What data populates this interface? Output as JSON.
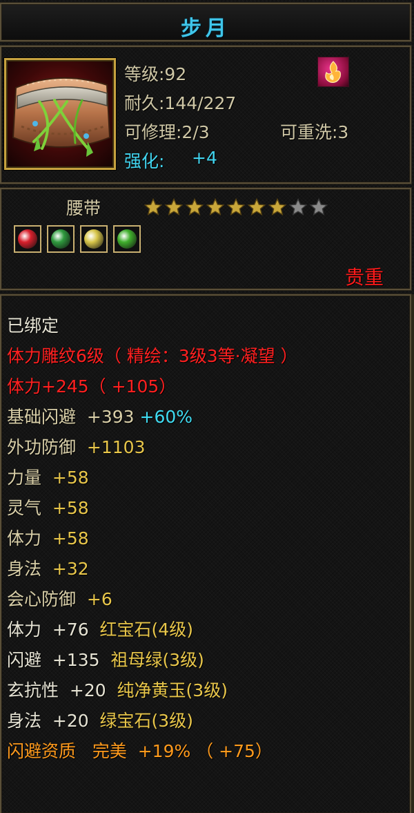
{
  "title": "步月",
  "title_color": "#3fc6ea",
  "item_icon": "belt-item-icon",
  "badge_icon": "flame-badge-icon",
  "stats": {
    "level": "等级:92",
    "durability": "耐久:144/227",
    "repair": "可修理:2/3",
    "rewash": "可重洗:3",
    "enhance_label": "强化:",
    "enhance_value": "+4"
  },
  "type": "腰带",
  "stars": {
    "filled": 7,
    "total": 9
  },
  "gems": [
    {
      "name": "ruby-gem-icon",
      "color": "#d8202c"
    },
    {
      "name": "emerald-gem-icon",
      "color": "#2f9a3e"
    },
    {
      "name": "jade-gem-icon",
      "color": "#d8c64a"
    },
    {
      "name": "green-gem-icon",
      "color": "#3fae2c"
    }
  ],
  "rarity": "贵重",
  "attributes": [
    {
      "parts": [
        {
          "text": "已绑定",
          "class": "c-white"
        }
      ]
    },
    {
      "parts": [
        {
          "text": "体力雕纹6级（ 精绘：3级3等·凝望 ）",
          "class": "c-red"
        }
      ]
    },
    {
      "parts": [
        {
          "text": "体力+245（ +105）",
          "class": "c-red"
        }
      ]
    },
    {
      "parts": [
        {
          "text": "基础闪避  +393 ",
          "class": "c-beige"
        },
        {
          "text": "+60%",
          "class": "c-cyan"
        }
      ]
    },
    {
      "parts": [
        {
          "text": "外功防御  ",
          "class": "c-beige"
        },
        {
          "text": "+1103",
          "class": "c-gold"
        }
      ]
    },
    {
      "parts": [
        {
          "text": "力量  ",
          "class": "c-beige"
        },
        {
          "text": "+58",
          "class": "c-gold"
        }
      ]
    },
    {
      "parts": [
        {
          "text": "灵气  ",
          "class": "c-beige"
        },
        {
          "text": "+58",
          "class": "c-gold"
        }
      ]
    },
    {
      "parts": [
        {
          "text": "体力  ",
          "class": "c-beige"
        },
        {
          "text": "+58",
          "class": "c-gold"
        }
      ]
    },
    {
      "parts": [
        {
          "text": "身法  ",
          "class": "c-beige"
        },
        {
          "text": "+32",
          "class": "c-gold"
        }
      ]
    },
    {
      "parts": [
        {
          "text": "会心防御  ",
          "class": "c-beige"
        },
        {
          "text": "+6",
          "class": "c-gold"
        }
      ]
    },
    {
      "parts": [
        {
          "text": "体力  +76  ",
          "class": "c-white"
        },
        {
          "text": "红宝石(4级)",
          "class": "c-gold"
        }
      ]
    },
    {
      "parts": [
        {
          "text": "闪避  +135  ",
          "class": "c-white"
        },
        {
          "text": "祖母绿(3级)",
          "class": "c-gold"
        }
      ]
    },
    {
      "parts": [
        {
          "text": "玄抗性  +20  ",
          "class": "c-white"
        },
        {
          "text": "纯净黄玉(3级)",
          "class": "c-gold"
        }
      ]
    },
    {
      "parts": [
        {
          "text": "身法  +20  ",
          "class": "c-white"
        },
        {
          "text": "绿宝石(3级)",
          "class": "c-gold"
        }
      ]
    },
    {
      "parts": [
        {
          "text": "闪避资质   完美  +19% （ +75）",
          "class": "c-orange"
        }
      ]
    }
  ]
}
